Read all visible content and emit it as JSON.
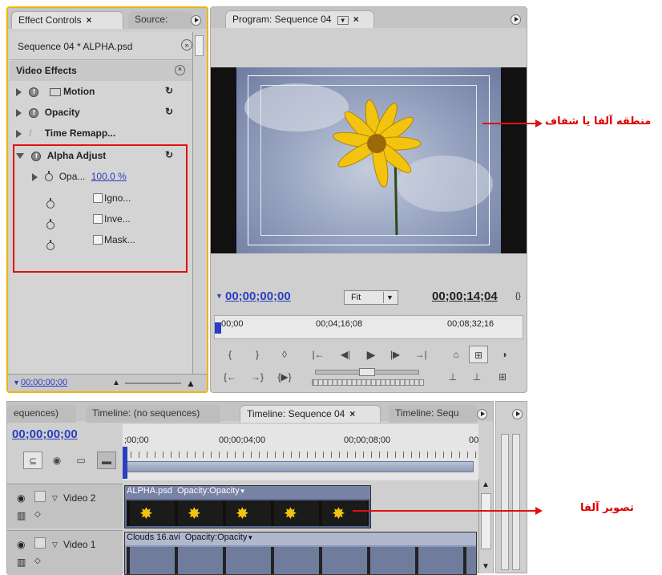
{
  "effect_controls": {
    "tab_label": "Effect Controls",
    "source_tab_label": "Source:",
    "sequence_clip": "Sequence 04 * ALPHA.psd",
    "video_effects_header": "Video Effects",
    "effects": [
      {
        "name": "Motion"
      },
      {
        "name": "Opacity"
      },
      {
        "name": "Time Remapp..."
      },
      {
        "name": "Alpha Adjust"
      }
    ],
    "opacity_param": "Opa...",
    "opacity_value": "100.0 %",
    "checkbox_params": [
      "Igno...",
      "Inve...",
      "Mask..."
    ],
    "bottom_timecode": "00;00;00;00"
  },
  "program_monitor": {
    "tab_label": "Program: Sequence 04",
    "current_timecode": "00;00;00;00",
    "zoom_select": "Fit",
    "duration_timecode": "00;00;14;04",
    "ruler_labels": [
      "00;00",
      "00;04;16;08",
      "00;08;32;16"
    ]
  },
  "timeline": {
    "tabs": [
      "equences)",
      "Timeline: (no sequences)",
      "Timeline: Sequence 04",
      "Timeline: Sequ"
    ],
    "timecode": "00;00;00;00",
    "ruler_labels": [
      ";00;00",
      "00;00;04;00",
      "00;00;08;00",
      "00"
    ],
    "tracks": [
      {
        "name": "Video 2",
        "clip_name": "ALPHA.psd",
        "clip_fx": "Opacity:Opacity"
      },
      {
        "name": "Video 1",
        "clip_name": "Clouds 16.avi",
        "clip_fx": "Opacity:Opacity"
      }
    ]
  },
  "annotations": {
    "alpha_area": "منطقه آلفا یا شفاف",
    "alpha_image": "تصویر آلفا"
  },
  "colors": {
    "highlight_border": "#f0b400",
    "annotation_red": "#e01010",
    "timecode_blue": "#2a3fbf"
  }
}
